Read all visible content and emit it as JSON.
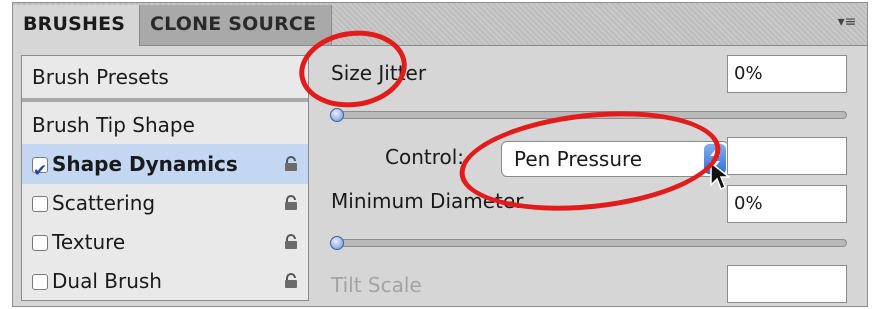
{
  "tabs": [
    {
      "label": "BRUSHES",
      "active": true
    },
    {
      "label": "CLONE SOURCE",
      "active": false
    }
  ],
  "panel_menu_icon": "panel-menu-icon",
  "left_list": {
    "presets_label": "Brush Presets",
    "items": [
      {
        "label": "Brush Tip Shape",
        "checkbox": false,
        "checked": false,
        "lock": false,
        "selected": false
      },
      {
        "label": "Shape Dynamics",
        "checkbox": true,
        "checked": true,
        "lock": true,
        "selected": true
      },
      {
        "label": "Scattering",
        "checkbox": true,
        "checked": false,
        "lock": true,
        "selected": false
      },
      {
        "label": "Texture",
        "checkbox": true,
        "checked": false,
        "lock": true,
        "selected": false
      },
      {
        "label": "Dual Brush",
        "checkbox": true,
        "checked": false,
        "lock": true,
        "selected": false
      }
    ]
  },
  "settings": {
    "size_jitter": {
      "label": "Size Jitter",
      "value": "0%",
      "slider_level": 0
    },
    "control": {
      "label": "Control:",
      "selected": "Pen Pressure",
      "value": ""
    },
    "minimum_diameter": {
      "label": "Minimum Diameter",
      "value": "0%",
      "slider_level": 0
    },
    "tilt_scale": {
      "label": "Tilt Scale",
      "value": "",
      "disabled": true
    }
  },
  "colors": {
    "selected_row": "#c3d7f2",
    "annotation": "#e31b1b",
    "slider_thumb": "#6a92d6"
  }
}
